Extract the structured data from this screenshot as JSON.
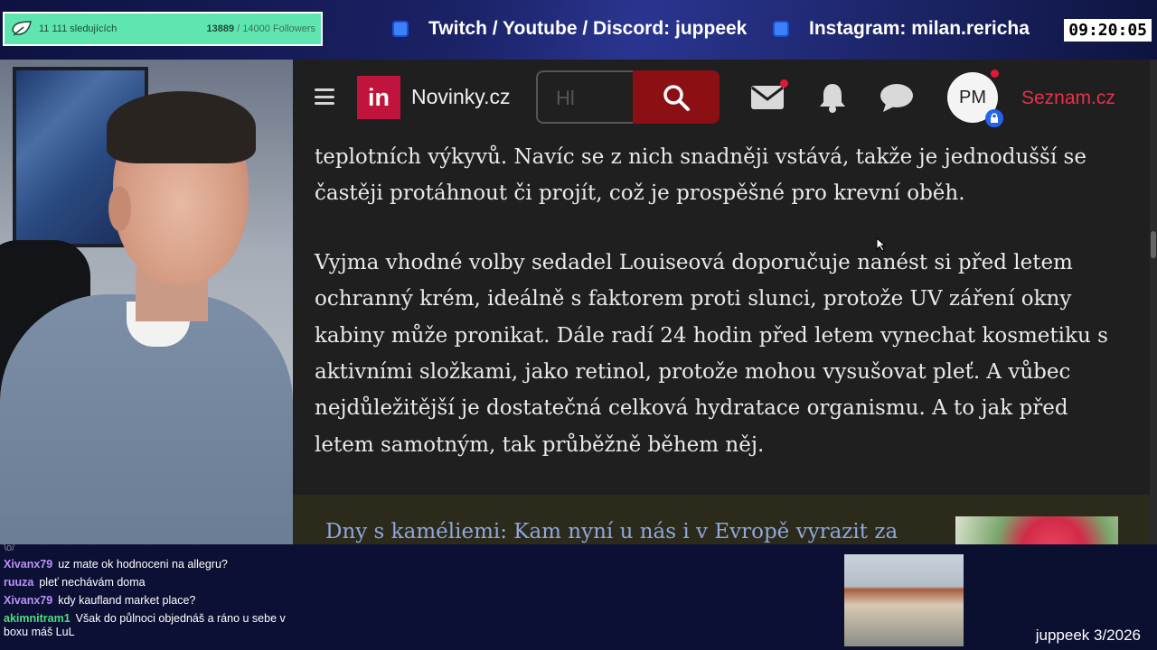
{
  "overlay": {
    "followers_label": "11 111 sledujících",
    "followers_current": "13889",
    "followers_goal": "/ 14000 Followers",
    "social_1": "Twitch / Youtube / Discord: juppeek",
    "social_2": "Instagram: milan.rericha",
    "clock": "09:20:05",
    "footer": "juppeek 3/2026"
  },
  "browser": {
    "brand": "Novinky.cz",
    "logo_text": "in",
    "search_placeholder": "Hl",
    "avatar_initials": "PM",
    "seznam_link": "Seznam.cz",
    "article_paragraphs": [
      "teplotních výkyvů. Navíc se z nich snadněji vstává, takže je jednodušší se častěji protáhnout či projít, což je prospěšné pro krevní oběh.",
      "Vyjma vhodné volby sedadel Louiseová doporučuje nanést si před letem ochranný krém, ideálně s faktorem proti slunci, protože UV záření okny kabiny může pronikat. Dále radí 24 hodin před letem vynechat kosmetiku s aktivními složkami, jako retinol, protože mohou vysušovat pleť. A vůbec nejdůležitější je dostatečná celková hydratace organismu. A to jak před letem samotným, tak průběžně během něj."
    ],
    "related_title": "Dny s kaméliemi: Kam nyní u nás i v Evropě vyrazit za"
  },
  "chat": {
    "messages": [
      {
        "user": "Xivanx79",
        "text": "uz mate ok hodnoceni na allegru?",
        "color": "#b794f6"
      },
      {
        "user": "ruuza",
        "text": "pleť nechávám doma",
        "color": "#b794f6"
      },
      {
        "user": "Xivanx79",
        "text": "kdy kaufland market place?",
        "color": "#b794f6"
      },
      {
        "user": "akimnitram1",
        "text": "Však do půlnoci objednáš a ráno u sebe v",
        "color": "#4ade80"
      },
      {
        "user": "",
        "text": "boxu máš LuL",
        "color": "#ffffff"
      }
    ]
  },
  "icons": {
    "search": "search-icon",
    "mail": "mail-icon",
    "bell": "bell-icon",
    "chat": "chat-icon",
    "menu": "hamburger-icon",
    "lock": "lock-icon"
  },
  "colors": {
    "brand_red": "#c0143c",
    "search_button": "#8c0f14",
    "follower_bar": "#5fe6b0",
    "seznam_red": "#e8304a",
    "link_blue": "#8ea8dd"
  }
}
